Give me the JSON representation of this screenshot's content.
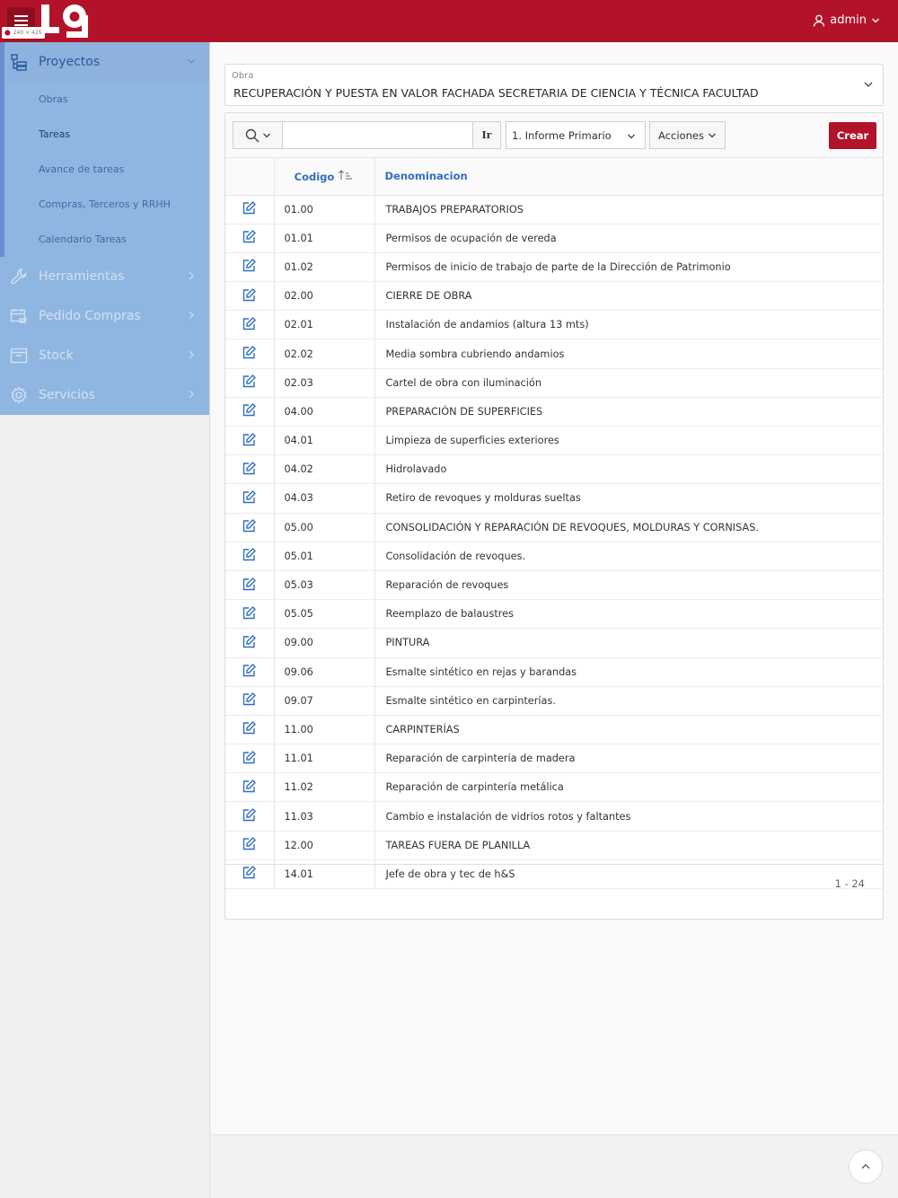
{
  "header": {
    "size_tag": "240 × 425",
    "user_label": "admin"
  },
  "sidebar": {
    "sections": [
      {
        "label": "Proyectos",
        "icon": "project-tree-icon",
        "expanded": true
      },
      {
        "label": "Herramientas",
        "icon": "wrench-icon"
      },
      {
        "label": "Pedido Compras",
        "icon": "calendar-cart-icon"
      },
      {
        "label": "Stock",
        "icon": "archive-box-icon"
      },
      {
        "label": "Servicios",
        "icon": "gear-icon"
      }
    ],
    "sub_items": [
      "Obras",
      "Tareas",
      "Avance de tareas",
      "Compras, Terceros y RRHH",
      "Calendario Tareas"
    ]
  },
  "obra": {
    "label": "Obra",
    "value": "RECUPERACIÓN Y PUESTA EN VALOR FACHADA SECRETARIA DE CIENCIA Y TÉCNICA FACULTAD"
  },
  "toolbar": {
    "search_value": "",
    "go_label": "Ir",
    "report_label": "1. Informe Primario",
    "actions_label": "Acciones",
    "create_label": "Crear"
  },
  "table": {
    "columns": {
      "code": "Codigo",
      "name": "Denominacion"
    },
    "rows": [
      {
        "code": "01.00",
        "name": "TRABAJOS PREPARATORIOS"
      },
      {
        "code": "01.01",
        "name": "Permisos de ocupación de vereda"
      },
      {
        "code": "01.02",
        "name": "Permisos de inicio de trabajo de parte de la Dirección de Patrimonio"
      },
      {
        "code": "02.00",
        "name": "CIERRE DE OBRA"
      },
      {
        "code": "02.01",
        "name": "Instalación de andamios (altura 13 mts)"
      },
      {
        "code": "02.02",
        "name": "Media sombra cubriendo andamios"
      },
      {
        "code": "02.03",
        "name": "Cartel de obra con iluminación"
      },
      {
        "code": "04.00",
        "name": "PREPARACIÓN DE SUPERFICIES"
      },
      {
        "code": "04.01",
        "name": "Limpieza de superficies exteriores"
      },
      {
        "code": "04.02",
        "name": "Hidrolavado"
      },
      {
        "code": "04.03",
        "name": "Retiro de revoques y molduras sueltas"
      },
      {
        "code": "05.00",
        "name": "CONSOLIDACIÓN Y REPARACIÓN DE REVOQUES, MOLDURAS Y CORNISAS."
      },
      {
        "code": "05.01",
        "name": "Consolidación de revoques."
      },
      {
        "code": "05.03",
        "name": "Reparación de revoques"
      },
      {
        "code": "05.05",
        "name": "Reemplazo de balaustres"
      },
      {
        "code": "09.00",
        "name": "PINTURA"
      },
      {
        "code": "09.06",
        "name": "Esmalte sintético en rejas y barandas"
      },
      {
        "code": "09.07",
        "name": "Esmalte sintético en carpinterías."
      },
      {
        "code": "11.00",
        "name": "CARPINTERÍAS"
      },
      {
        "code": "11.01",
        "name": "Reparación de carpintería de madera"
      },
      {
        "code": "11.02",
        "name": "Reparación de carpintería metálica"
      },
      {
        "code": "11.03",
        "name": "Cambio e instalación de vidrios rotos y faltantes"
      },
      {
        "code": "12.00",
        "name": "TAREAS FUERA DE PLANILLA"
      },
      {
        "code": "14.01",
        "name": "Jefe de obra y tec de h&S"
      }
    ],
    "pagination": "1 - 24"
  },
  "colors": {
    "brand": "#b2132a",
    "nav_bg": "#8fb6e0",
    "link": "#2f6fc2"
  }
}
